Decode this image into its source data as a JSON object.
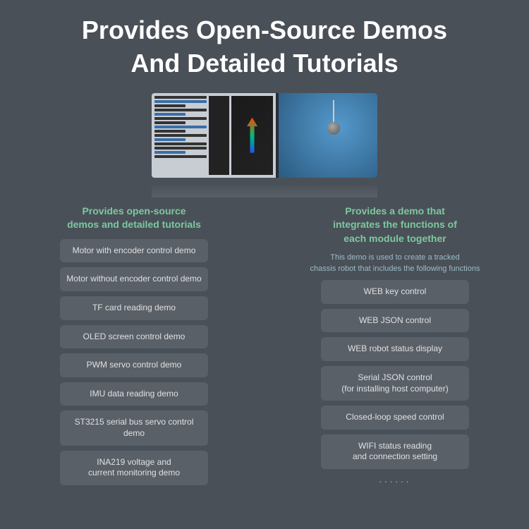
{
  "header": {
    "title_line1": "Provides Open-Source Demos",
    "title_line2": "And Detailed Tutorials"
  },
  "left_col": {
    "heading": "Provides open-source\ndemos and detailed tutorials",
    "buttons": [
      "Motor with encoder control demo",
      "Motor without encoder control demo",
      "TF card reading demo",
      "OLED screen control demo",
      "PWM servo control demo",
      "IMU data reading demo",
      "ST3215 serial bus servo control demo",
      "INA219 voltage and\ncurrent monitoring demo"
    ]
  },
  "right_col": {
    "heading": "Provides a demo that\nintegrates the functions of\neach module together",
    "description": "This demo is used to create a tracked\nchassis robot that includes the following functions",
    "buttons": [
      "WEB key control",
      "WEB JSON control",
      "WEB robot status display",
      "Serial JSON control\n(for installing host computer)",
      "Closed-loop speed control",
      "WIFI status reading\nand connection setting"
    ],
    "dots": "······"
  }
}
